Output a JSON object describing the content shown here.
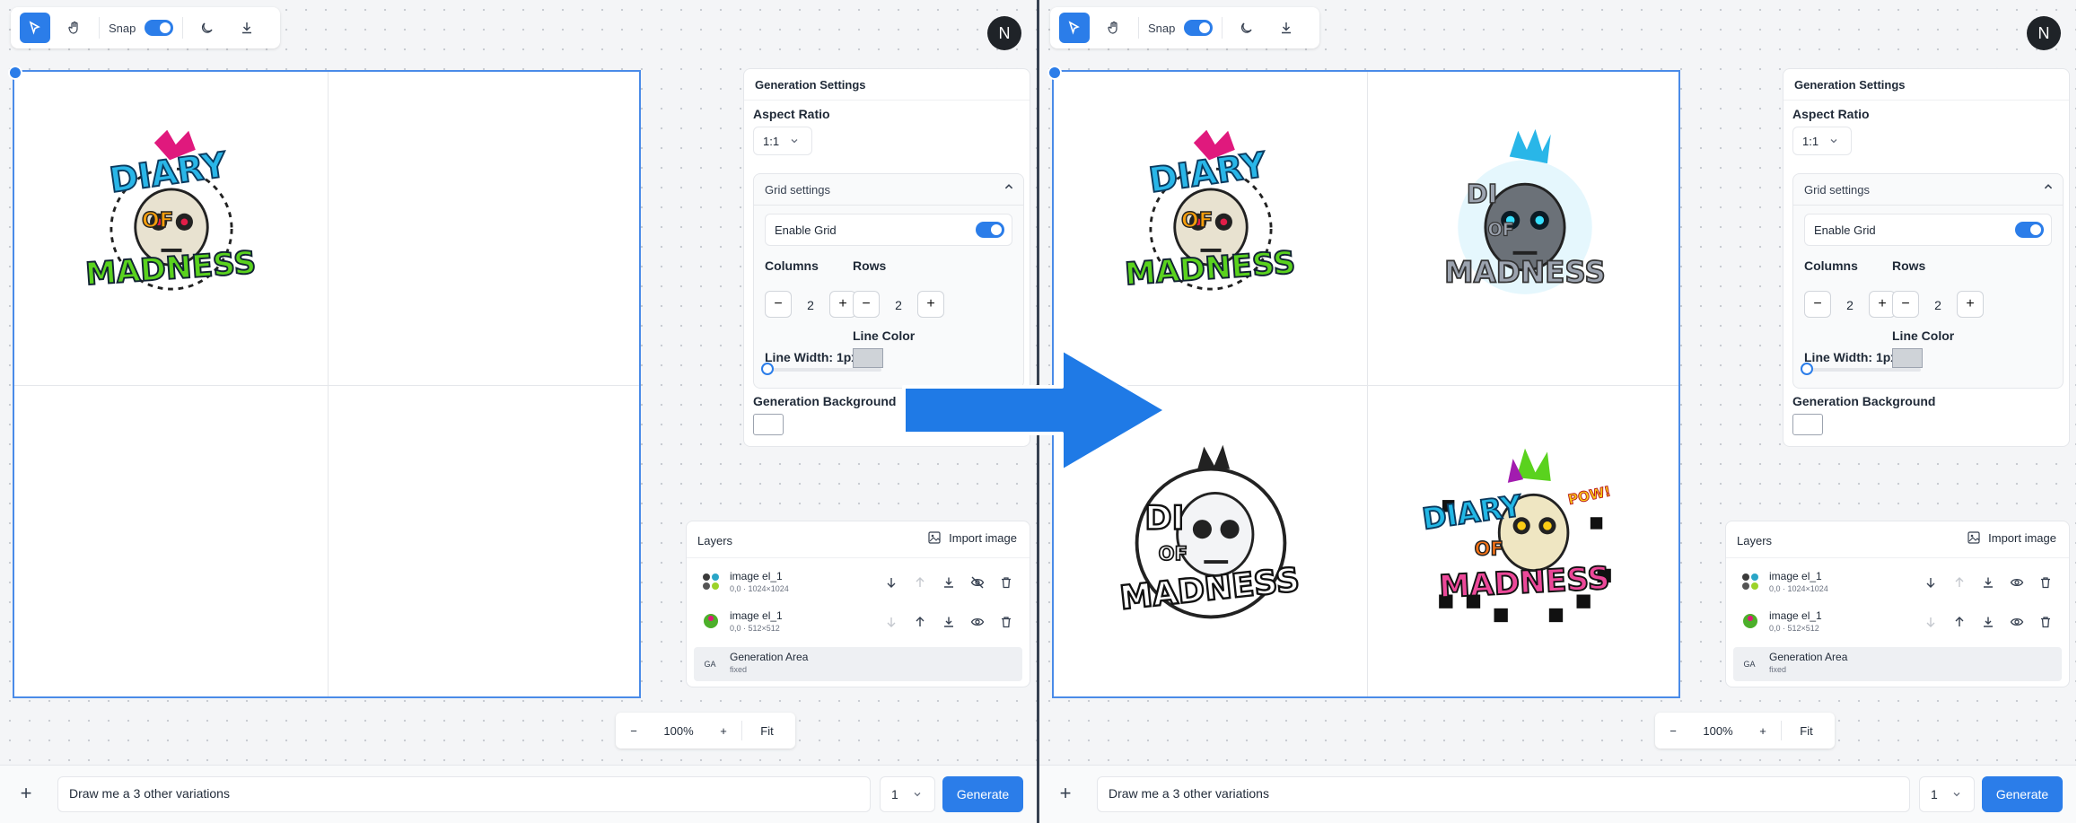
{
  "toolbar": {
    "snap_label": "Snap"
  },
  "user": {
    "avatar_initial": "N"
  },
  "settings": {
    "title": "Generation Settings",
    "aspect_ratio_label": "Aspect Ratio",
    "aspect_ratio_value": "1:1",
    "grid_settings_label": "Grid settings",
    "enable_grid_label": "Enable Grid",
    "enable_grid_on": true,
    "columns_label": "Columns",
    "columns_value": "2",
    "rows_label": "Rows",
    "rows_value": "2",
    "line_width_label": "Line Width: 1px",
    "line_color_label": "Line Color",
    "line_color": "#cfd3d8",
    "generation_background_label": "Generation Background",
    "generation_background": "#ffffff"
  },
  "layers": {
    "title": "Layers",
    "import_label": "Import image",
    "items": [
      {
        "name": "image el_1",
        "meta": "0,0 · 1024×1024",
        "visible": false
      },
      {
        "name": "image el_1",
        "meta": "0,0 · 512×512",
        "visible": true
      }
    ],
    "generation_area": {
      "badge": "GA",
      "name": "Generation Area",
      "meta": "fixed"
    }
  },
  "zoom": {
    "minus": "−",
    "level": "100%",
    "plus": "+",
    "fit": "Fit"
  },
  "prompt": {
    "value": "Draw me a 3 other variations",
    "count": "1",
    "generate_label": "Generate"
  },
  "artwork": {
    "word1": "DIARY",
    "word2": "OF",
    "word3": "MADNESS",
    "word_gray1": "DI",
    "word_gray3": "MADNESS",
    "word_bw1": "DI",
    "word_bw3": "MADNESS",
    "pow": "POW!"
  },
  "colors": {
    "accent": "#2b7de9",
    "canvas_border": "#4a8be8",
    "arrow": "#1f7ae6"
  }
}
